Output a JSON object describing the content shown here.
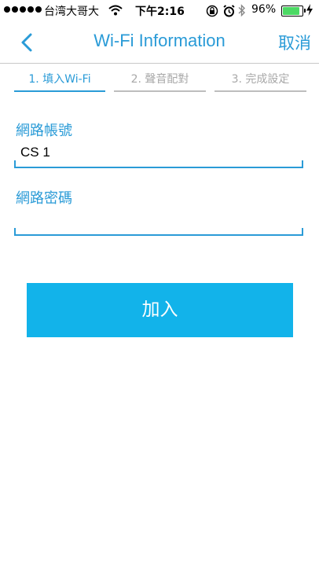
{
  "status_bar": {
    "carrier": "台湾大哥大",
    "time": "下午2:16",
    "battery_percent": "96%",
    "battery_level": 0.96
  },
  "nav": {
    "title": "Wi-Fi Information",
    "cancel_label": "取消",
    "back_icon": "chevron-left-icon"
  },
  "steps": [
    {
      "label": "1. 填入Wi-Fi",
      "active": true
    },
    {
      "label": "2. 聲音配對",
      "active": false
    },
    {
      "label": "3. 完成設定",
      "active": false
    }
  ],
  "form": {
    "ssid_label": "網路帳號",
    "ssid_value": "CS 1",
    "password_label": "網路密碼",
    "password_value": ""
  },
  "join_label": "加入",
  "colors": {
    "accent": "#2a9bd7",
    "button": "#12b3ea",
    "battery": "#4cd964"
  }
}
